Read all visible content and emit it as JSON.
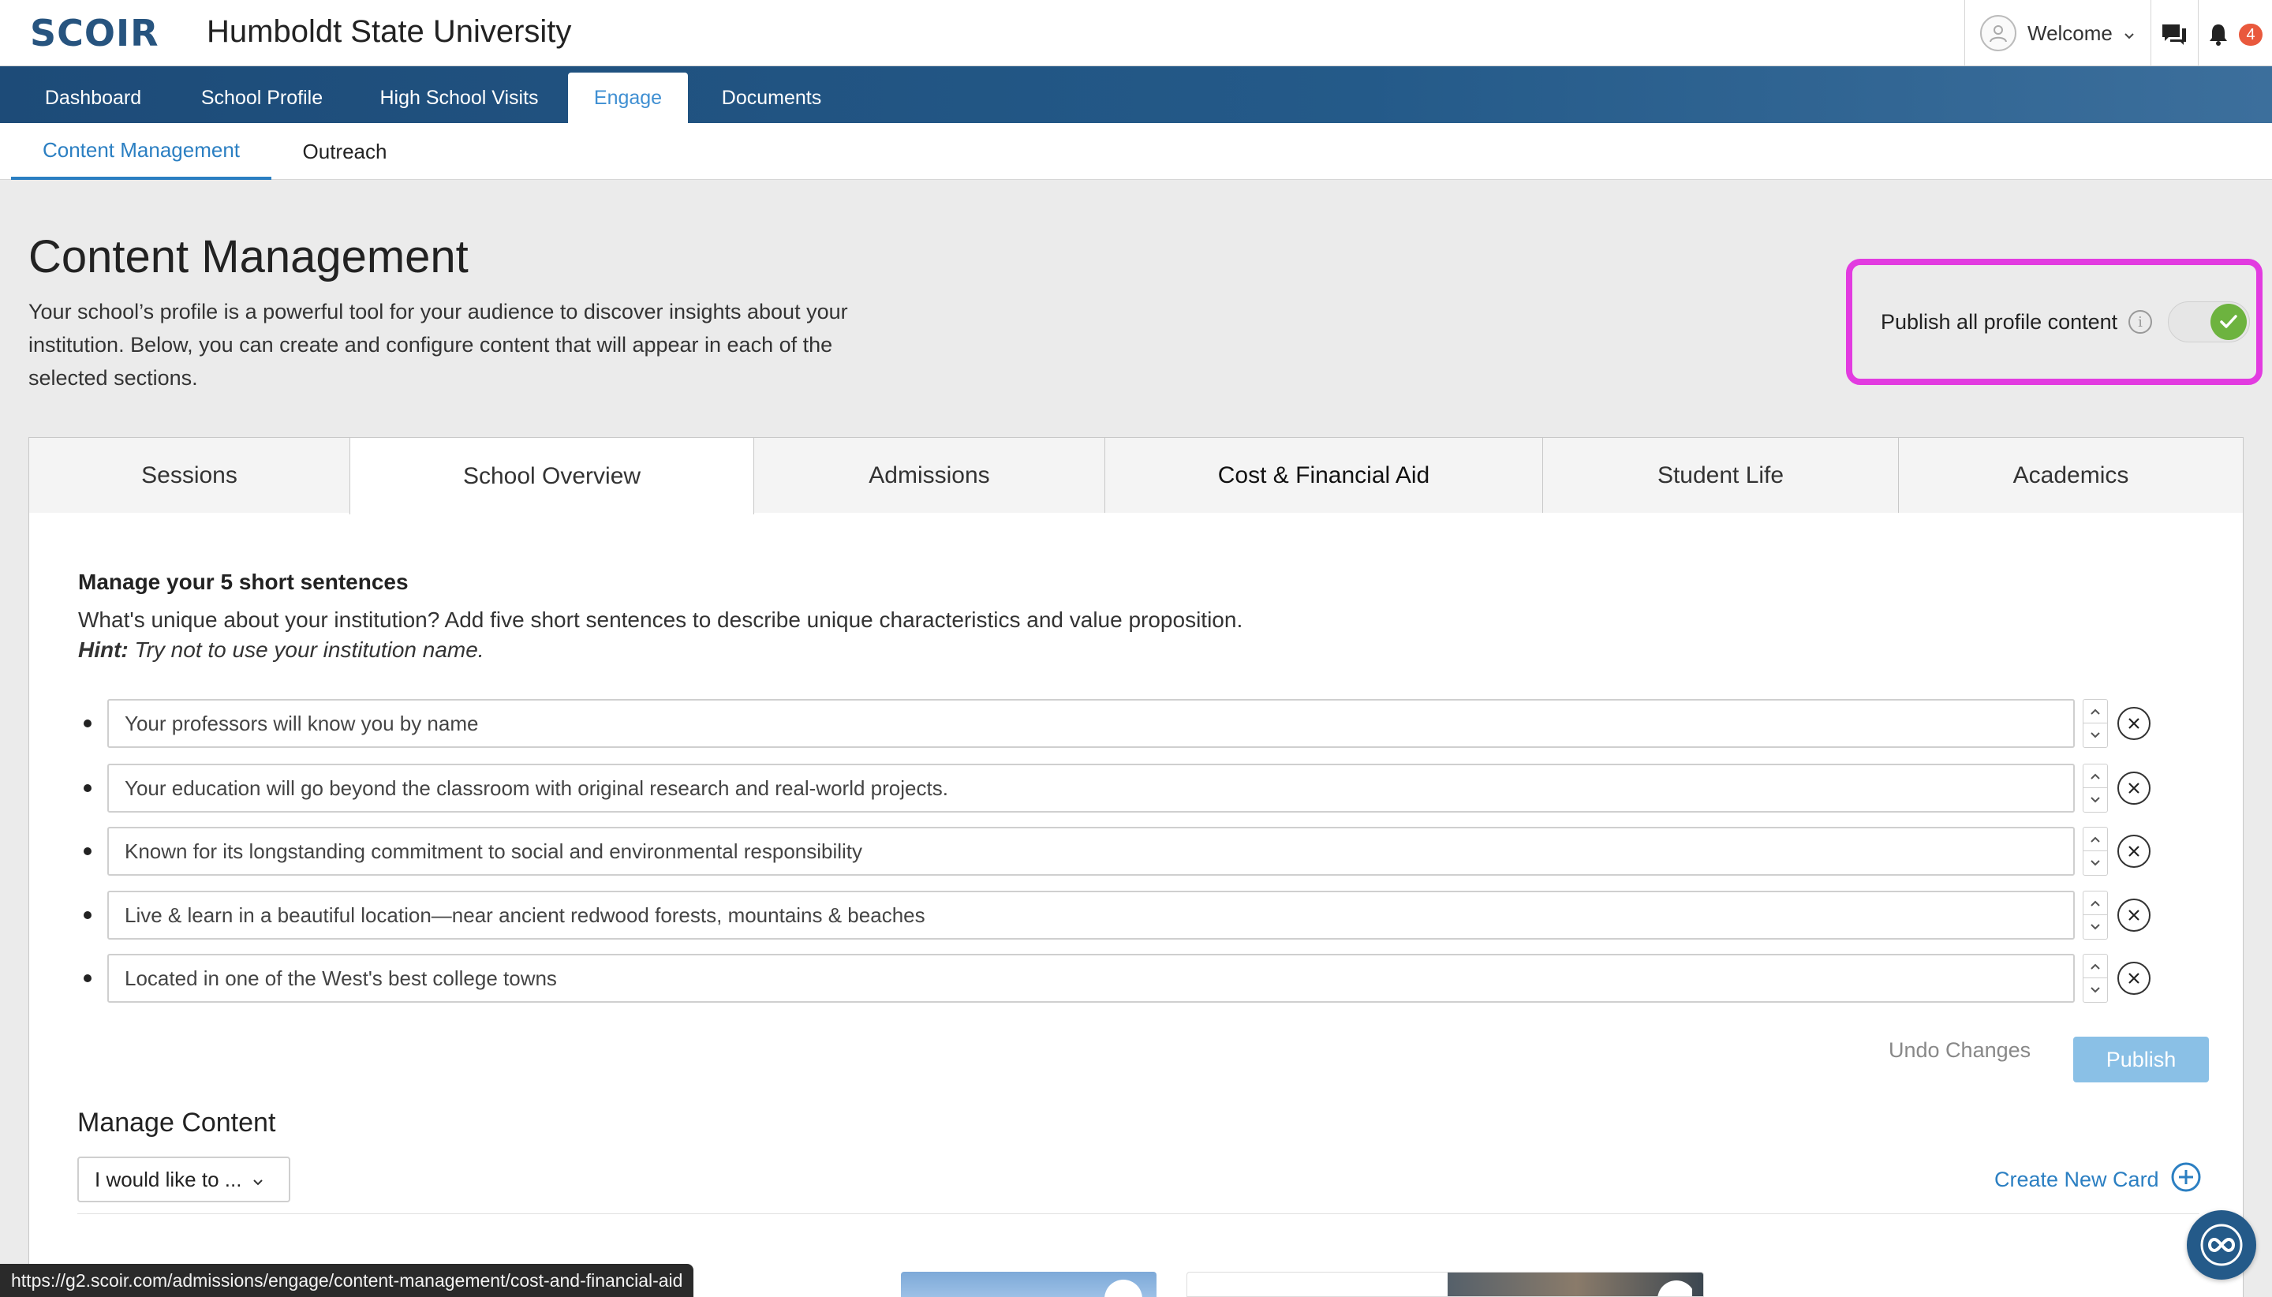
{
  "header": {
    "logo_text": "SCOIR",
    "school_name": "Humboldt State University",
    "welcome_label": "Welcome",
    "notification_count": "4",
    "brand_color": "#27547f",
    "badge_color": "#e9593d"
  },
  "main_nav": {
    "items": [
      {
        "label": "Dashboard"
      },
      {
        "label": "School Profile"
      },
      {
        "label": "High School Visits"
      },
      {
        "label": "Engage",
        "active": true
      },
      {
        "label": "Documents"
      }
    ]
  },
  "sub_nav": {
    "items": [
      {
        "label": "Content Management",
        "active": true
      },
      {
        "label": "Outreach"
      }
    ]
  },
  "page": {
    "title": "Content Management",
    "description": "Your school’s profile is a powerful tool for your audience to discover insights about your institution. Below, you can create and configure content that will appear in each of the selected sections.",
    "publish_all_label": "Publish all profile content",
    "publish_all_enabled": true,
    "highlight_color": "#e23be0",
    "toggle_color": "#6db33f"
  },
  "tabs": [
    {
      "label": "Sessions"
    },
    {
      "label": "School Overview",
      "active": true
    },
    {
      "label": "Admissions"
    },
    {
      "label": "Cost & Financial Aid"
    },
    {
      "label": "Student Life"
    },
    {
      "label": "Academics"
    }
  ],
  "sentences_section": {
    "title": "Manage your 5 short sentences",
    "description": "What's unique about your institution? Add five short sentences to describe unique characteristics and value proposition.",
    "hint_label": "Hint:",
    "hint_text": " Try not to use your institution name.",
    "sentences": [
      "Your professors will know you by name",
      "Your education will go beyond the classroom with original research and real-world projects.",
      "Known for its longstanding commitment to social and environmental responsibility",
      "Live & learn in a beautiful location—near ancient redwood forests, mountains & beaches",
      "Located in one of the West's best college towns"
    ],
    "undo_label": "Undo Changes",
    "publish_label": "Publish"
  },
  "manage_content": {
    "title": "Manage Content",
    "select_value": "I would like to ...",
    "create_card_label": "Create New Card"
  },
  "status_bar": {
    "url": "https://g2.scoir.com/admissions/engage/content-management/cost-and-financial-aid"
  }
}
